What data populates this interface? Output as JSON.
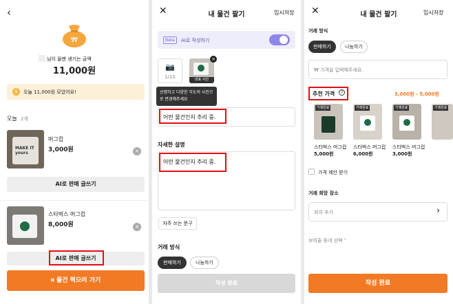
{
  "panel1": {
    "blur_name": "",
    "subtitle": "님이 올팬 생기는 금액",
    "amount": "11,000원",
    "banner_text": "오늘 11,000원 모았어요!",
    "today_label": "오늘",
    "today_count": "2개",
    "items": [
      {
        "name": "머그컵",
        "price": "3,000원",
        "mug_text": "MAKE IT yours",
        "button": "AI로 판매 글쓰기"
      },
      {
        "name": "스타벅스 머그컵",
        "price": "8,000원",
        "button": "AI로 판매 글쓰기"
      }
    ],
    "camera_button": "물건 찍으러 가기"
  },
  "panel2": {
    "title": "내 물건 팔기",
    "save": "임시저장",
    "beta": "Beta",
    "ai_label": "AI로 작성하기",
    "photo_count": "1/10",
    "rep_photo": "대표 사진",
    "tooltip": "선명하고 다양한 각도의 사진으로 변경해주세요",
    "title_input": "어떤 물건인지 추리 중.",
    "desc_label": "자세한 설명",
    "desc_input": "어떤 물건인지 추리 중.",
    "phrase_button": "자주 쓰는 문구",
    "trade_label": "거래 방식",
    "sell": "판매하기",
    "share": "나눔하기",
    "submit": "작성 완료"
  },
  "panel3": {
    "title": "내 물건 팔기",
    "save": "임시저장",
    "trade_label": "거래 방식",
    "sell": "판매하기",
    "share": "나눔하기",
    "price_placeholder": "₩ 가격을 입력해주세요.",
    "rec_label": "추천 가격",
    "rec_range": "3,000원 - 5,000원",
    "badge": "거래완료",
    "rec_items": [
      {
        "name": "스타벅스 머그컵",
        "price": "5,000원"
      },
      {
        "name": "스타벅스 머그컵",
        "price": "6,000원"
      },
      {
        "name": "스타벅스 머그컵",
        "price": "3,000원"
      }
    ],
    "offer": "가격 제안 받기",
    "place_label": "거래 희망 장소",
    "place_input": "위치 추가",
    "area_link": "보여줄 동네 선택",
    "submit": "작성 완료"
  },
  "colors": {
    "accent": "#f27a24",
    "highlight": "#e20d14",
    "toggle": "#8f86e8"
  }
}
